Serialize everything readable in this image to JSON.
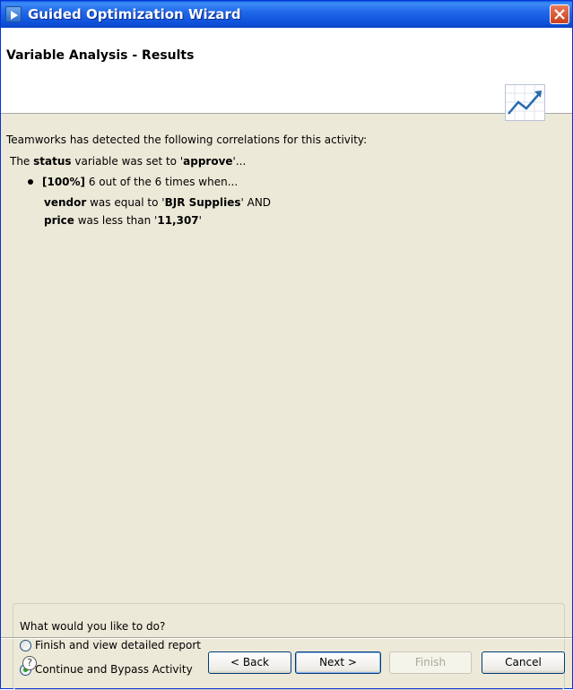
{
  "window": {
    "title": "Guided Optimization Wizard"
  },
  "header": {
    "title": "Variable Analysis - Results"
  },
  "content": {
    "intro": "Teamworks has detected the following correlations for this activity:",
    "result": {
      "prefix": "The ",
      "variable": "status",
      "middle": " variable was set to '",
      "value": "approve",
      "suffix": "'..."
    },
    "finding": {
      "percent": "[100%]",
      "text": " 6 out of the 6 times when..."
    },
    "conditions": [
      {
        "var": "vendor",
        "op": " was equal to '",
        "value": "BJR Supplies",
        "tail": "' AND"
      },
      {
        "var": "price",
        "op": " was less than '",
        "value": "11,307",
        "tail": "'"
      }
    ]
  },
  "options": {
    "question": "What would you like to do?",
    "choices": [
      {
        "label": "Finish and view detailed report",
        "selected": false
      },
      {
        "label": "Continue and Bypass Activity",
        "selected": true
      }
    ]
  },
  "buttons": {
    "help": "?",
    "back": "< Back",
    "next": "Next >",
    "finish": "Finish",
    "cancel": "Cancel"
  }
}
